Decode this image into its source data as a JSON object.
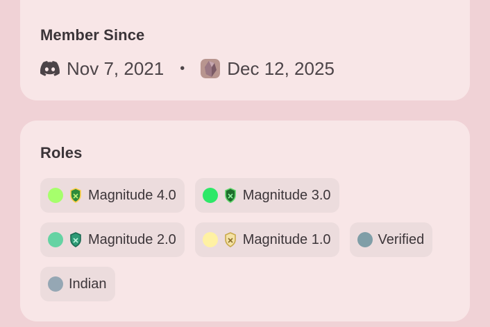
{
  "member_since": {
    "title": "Member Since",
    "discord_date": "Nov 7, 2021",
    "separator": "•",
    "server_date": "Dec 12, 2025",
    "discord_icon": "discord-logo-icon",
    "server_icon": "server-avatar-icon"
  },
  "roles": {
    "title": "Roles",
    "items": [
      {
        "label": "Magnitude 4.0",
        "color": "#a6ff6c",
        "emoji": "crest-badge-icon",
        "emoji_color": "#2f8a3a"
      },
      {
        "label": "Magnitude 3.0",
        "color": "#2ee868",
        "emoji": "crest-badge-icon",
        "emoji_color": "#1e6d2c"
      },
      {
        "label": "Magnitude 2.0",
        "color": "#65d3a3",
        "emoji": "crest-badge-icon",
        "emoji_color": "#2f9a76"
      },
      {
        "label": "Magnitude 1.0",
        "color": "#fff1a3",
        "emoji": "crest-badge-icon",
        "emoji_color": "#c9a94b"
      },
      {
        "label": "Verified",
        "color": "#7f9ea7"
      },
      {
        "label": "Indian",
        "color": "#95a7b4"
      }
    ]
  }
}
